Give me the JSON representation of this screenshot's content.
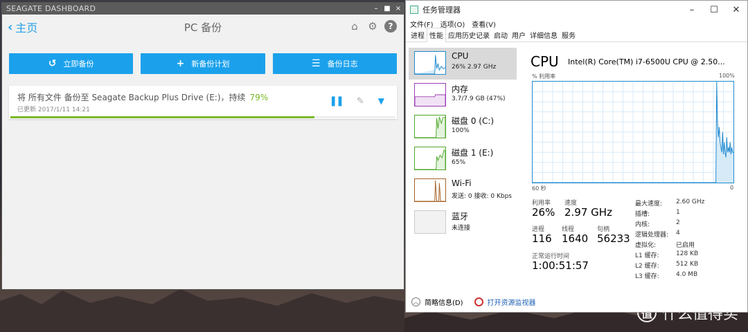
{
  "seagate": {
    "window_title": "SEAGATE DASHBOARD",
    "window_controls": [
      "–",
      "■",
      "×"
    ],
    "back_label": "主页",
    "page_title": "PC 备份",
    "buttons": {
      "backup_now": "立即备份",
      "new_plan": "新备份计划",
      "log": "备份日志"
    },
    "task": {
      "description": "将 所有文件 备份至 Seagate Backup Plus Drive (E:)，持续",
      "percent": "79%",
      "progress": 0.79,
      "updated": "已更新 2017/1/11 14:21"
    },
    "accent_color": "#1ba1ec",
    "progress_color": "#7ab828"
  },
  "taskmgr": {
    "window_title": "任务管理器",
    "menu": [
      "文件(F)",
      "选项(O)",
      "查看(V)"
    ],
    "tabs": [
      "进程",
      "性能",
      "应用历史记录",
      "启动",
      "用户",
      "详细信息",
      "服务"
    ],
    "active_tab": "性能",
    "sidebar": [
      {
        "name": "CPU",
        "sub": "26% 2.97 GHz",
        "color": "#1f8ad0"
      },
      {
        "name": "内存",
        "sub": "3.7/7.9 GB (47%)",
        "color": "#9b3fb5"
      },
      {
        "name": "磁盘 0 (C:)",
        "sub": "100%",
        "color": "#4ea72a"
      },
      {
        "name": "磁盘 1 (E:)",
        "sub": "65%",
        "color": "#4ea72a"
      },
      {
        "name": "Wi-Fi",
        "sub": "发送: 0 接收: 0 Kbps",
        "color": "#a7642a"
      },
      {
        "name": "蓝牙",
        "sub": "未连接",
        "color": "#bbbbbb"
      }
    ],
    "cpu": {
      "title": "CPU",
      "model": "Intel(R) Core(TM) i7-6500U CPU @ 2.50...",
      "graph_label": "% 利用率",
      "graph_max": "100%",
      "graph_time": "60 秒",
      "graph_min": "0",
      "util_values": [
        0,
        0,
        0,
        0,
        0,
        0,
        0,
        0,
        0,
        0,
        0,
        0,
        0,
        0,
        0,
        0,
        0,
        0,
        0,
        0,
        0,
        0,
        0,
        0,
        0,
        0,
        0,
        0,
        0,
        0,
        0,
        0,
        0,
        0,
        0,
        0,
        0,
        0,
        0,
        0,
        0,
        0,
        0,
        0,
        0,
        0,
        0,
        0,
        0,
        0,
        0,
        0,
        0,
        0,
        0,
        0,
        0,
        0,
        0,
        0,
        0,
        0,
        0,
        0,
        0,
        0,
        0,
        0,
        0,
        0,
        0,
        0,
        0,
        0,
        0,
        0,
        0,
        0,
        0,
        0,
        0,
        0,
        0,
        0,
        0,
        0,
        0,
        0,
        0,
        0,
        0,
        0,
        0,
        0,
        0,
        0,
        0,
        0,
        0,
        0,
        0,
        0,
        0,
        0,
        0,
        0,
        0,
        0,
        0,
        0,
        0,
        0,
        0,
        0,
        0,
        0,
        0,
        0,
        0,
        0,
        0,
        0,
        0,
        0,
        0,
        0,
        0,
        0,
        0,
        0,
        0,
        0,
        0,
        0,
        0,
        0,
        0,
        0,
        0,
        0,
        0,
        0,
        0,
        0,
        0,
        0,
        0,
        0,
        0,
        0,
        0,
        0,
        0,
        0,
        0,
        0,
        0,
        0,
        0,
        0,
        0,
        0,
        0,
        0,
        0,
        0,
        0,
        0,
        0,
        0,
        0,
        0,
        0,
        0,
        0,
        0,
        0,
        0,
        0,
        0,
        0,
        0,
        0,
        0,
        0,
        0,
        0,
        0,
        0,
        0,
        0,
        0,
        0,
        0,
        0,
        0,
        0,
        0,
        0,
        0,
        0,
        0,
        0,
        0,
        0,
        0,
        0,
        0,
        0,
        0,
        0,
        0,
        0,
        0,
        0,
        0,
        0,
        0,
        0,
        0,
        100,
        60,
        45,
        55,
        40,
        35,
        30,
        50,
        28,
        40,
        30,
        25,
        45,
        30,
        35,
        30,
        40,
        28,
        35,
        30,
        30
      ],
      "stats": {
        "util_label": "利用率",
        "util": "26%",
        "speed_label": "速度",
        "speed": "2.97 GHz",
        "proc_label": "进程",
        "proc": "116",
        "threads_label": "线程",
        "threads": "1640",
        "handles_label": "句柄",
        "handles": "56233",
        "uptime_label": "正常运行时间",
        "uptime": "1:00:51:57"
      },
      "specs": [
        {
          "k": "最大速度:",
          "v": "2.60 GHz"
        },
        {
          "k": "插槽:",
          "v": "1"
        },
        {
          "k": "内核:",
          "v": "2"
        },
        {
          "k": "逻辑处理器:",
          "v": "4"
        },
        {
          "k": "虚拟化:",
          "v": "已启用"
        },
        {
          "k": "L1 缓存:",
          "v": "128 KB"
        },
        {
          "k": "L2 缓存:",
          "v": "512 KB"
        },
        {
          "k": "L3 缓存:",
          "v": "4.0 MB"
        }
      ]
    },
    "footer": {
      "brief": "简略信息(D)",
      "open_monitor": "打开资源监视器"
    }
  },
  "watermark": {
    "logo": "值",
    "text": "什么值得买"
  }
}
